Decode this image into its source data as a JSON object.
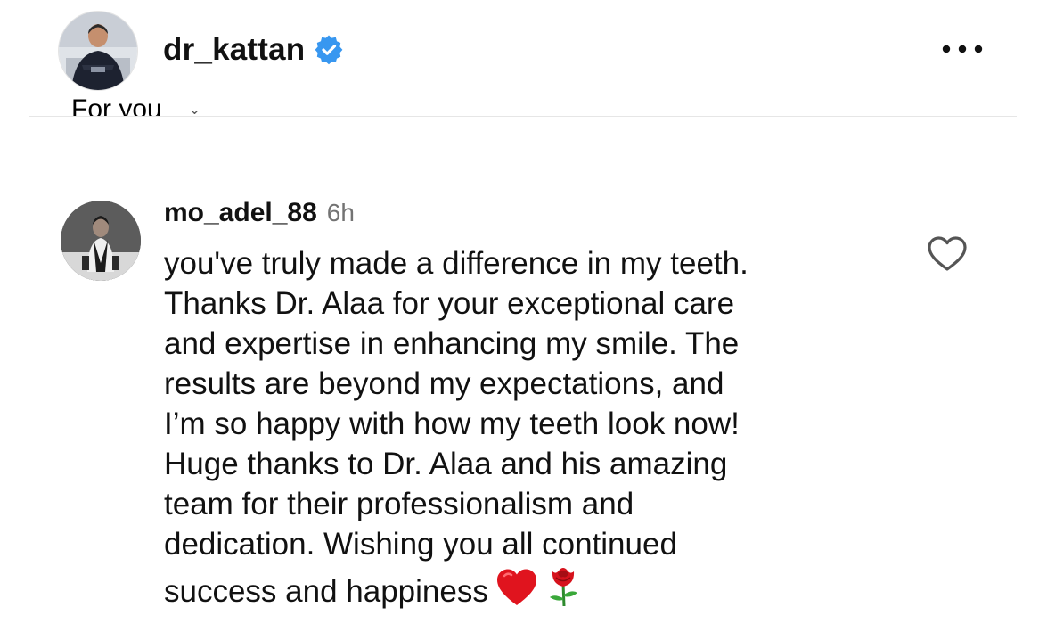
{
  "post_header": {
    "username": "dr_kattan",
    "verified_icon": "verified-badge-icon",
    "more_icon": "more-options-icon"
  },
  "sort": {
    "label": "For you",
    "icon": "chevron-down-icon"
  },
  "comment": {
    "username": "mo_adel_88",
    "time": "6h",
    "lines": [
      "you've truly made a difference in my teeth.",
      "Thanks Dr. Alaa for your exceptional care",
      "and expertise in enhancing my smile. The",
      "results are beyond my expectations, and",
      "I’m so happy with how my teeth look now!",
      "Huge thanks to Dr. Alaa and his amazing",
      "team for their professionalism and",
      "dedication. Wishing you all continued",
      "success and happiness"
    ],
    "emojis": [
      "red-heart-icon",
      "rose-icon"
    ],
    "like_icon": "heart-outline-icon"
  },
  "colors": {
    "verified_blue": "#3897f0",
    "muted_text": "#737373",
    "divider": "#e6e6e6"
  }
}
